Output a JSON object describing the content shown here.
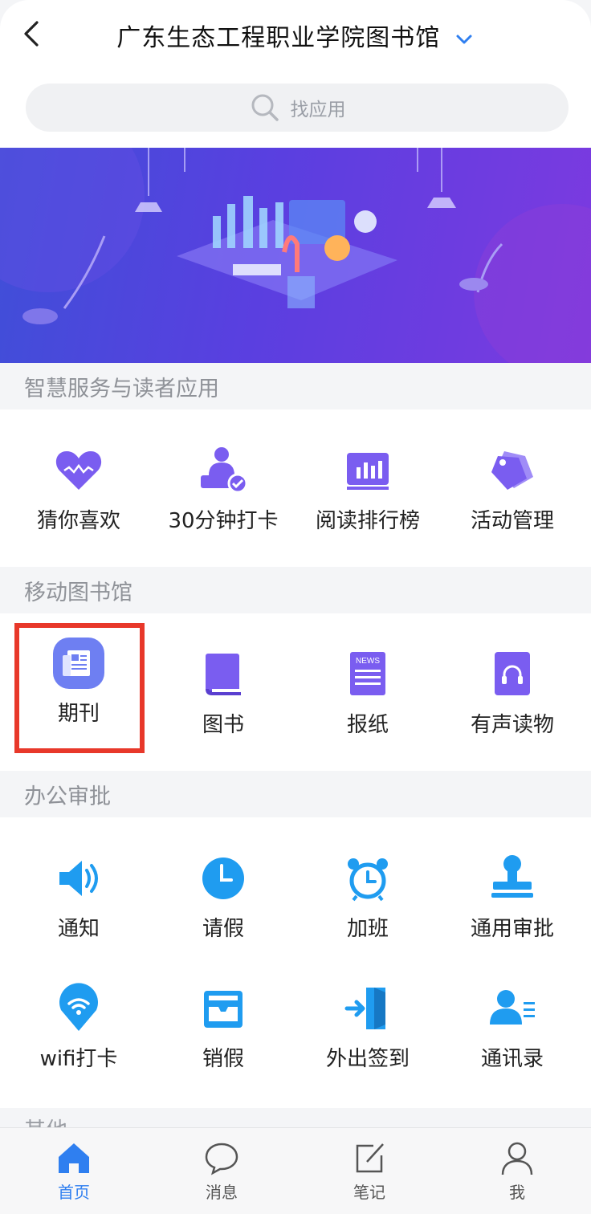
{
  "header": {
    "title": "广东生态工程职业学院图书馆"
  },
  "search": {
    "placeholder": "找应用"
  },
  "sections": {
    "smart": {
      "title": "智慧服务与读者应用",
      "items": [
        {
          "label": "猜你喜欢",
          "icon": "heart-icon"
        },
        {
          "label": "30分钟打卡",
          "icon": "checkin-person-icon"
        },
        {
          "label": "阅读排行榜",
          "icon": "bar-chart-icon"
        },
        {
          "label": "活动管理",
          "icon": "tags-icon"
        }
      ]
    },
    "mobile_library": {
      "title": "移动图书馆",
      "items": [
        {
          "label": "期刊",
          "icon": "journal-icon"
        },
        {
          "label": "图书",
          "icon": "book-icon"
        },
        {
          "label": "报纸",
          "icon": "newspaper-icon"
        },
        {
          "label": "有声读物",
          "icon": "audiobook-icon"
        }
      ]
    },
    "office": {
      "title": "办公审批",
      "items": [
        {
          "label": "通知",
          "icon": "speaker-icon"
        },
        {
          "label": "请假",
          "icon": "clock-icon"
        },
        {
          "label": "加班",
          "icon": "alarm-clock-icon"
        },
        {
          "label": "通用审批",
          "icon": "stamp-icon"
        },
        {
          "label": "wifi打卡",
          "icon": "wifi-pin-icon"
        },
        {
          "label": "销假",
          "icon": "inbox-icon"
        },
        {
          "label": "外出签到",
          "icon": "exit-door-icon"
        },
        {
          "label": "通讯录",
          "icon": "contacts-icon"
        }
      ]
    },
    "other": {
      "title": "其他"
    }
  },
  "tabs": [
    {
      "label": "首页",
      "icon": "home-icon",
      "active": true
    },
    {
      "label": "消息",
      "icon": "chat-bubble-icon",
      "active": false
    },
    {
      "label": "笔记",
      "icon": "note-edit-icon",
      "active": false
    },
    {
      "label": "我",
      "icon": "person-icon",
      "active": false
    }
  ],
  "colors": {
    "accent_purple": "#7a5df0",
    "accent_blue": "#1f9cf0",
    "highlight_red": "#e8382a",
    "tab_active": "#2f7ff0"
  }
}
